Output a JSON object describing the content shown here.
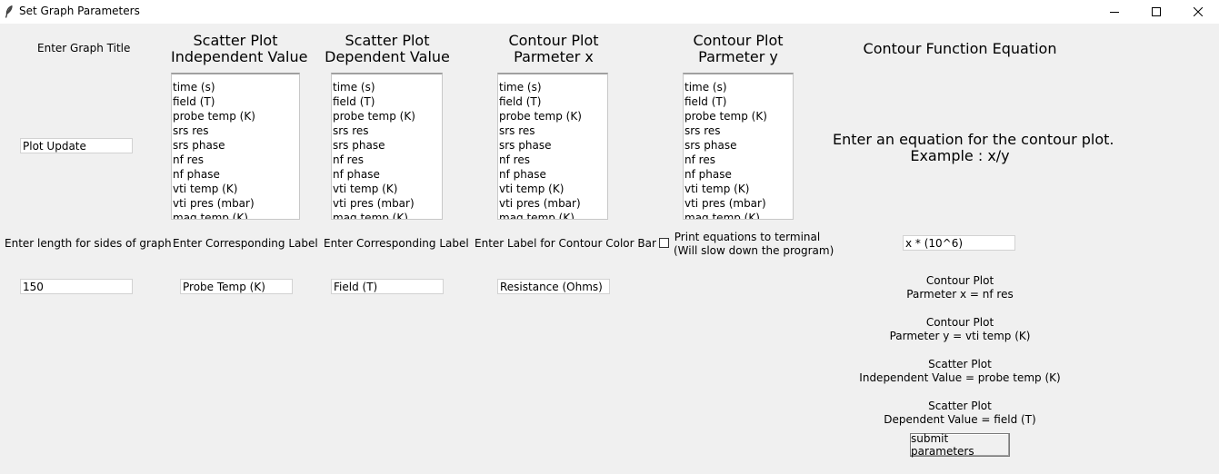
{
  "window": {
    "title": "Set Graph Parameters",
    "icon": "feather-icon",
    "controls": [
      "minimize-icon",
      "maximize-icon",
      "close-icon"
    ]
  },
  "graph_title": {
    "label": "Enter Graph Title",
    "value": "Plot Update"
  },
  "side_length": {
    "label": "Enter length for sides of graph",
    "value": "150"
  },
  "listbox_options": [
    "time (s)",
    "field (T)",
    "probe temp (K)",
    "srs res",
    "srs phase",
    "nf res",
    "nf phase",
    "vti temp (K)",
    "vti pres (mbar)",
    "mag temp (K)"
  ],
  "scatter_independent": {
    "heading_line1": "Scatter Plot",
    "heading_line2": "Independent Value",
    "label_prompt": "Enter Corresponding Label",
    "label_value": "Probe Temp (K)"
  },
  "scatter_dependent": {
    "heading_line1": "Scatter Plot",
    "heading_line2": "Dependent Value",
    "label_prompt": "Enter Corresponding Label",
    "label_value": "Field (T)"
  },
  "contour_x": {
    "heading_line1": "Contour Plot",
    "heading_line2": "Parmeter x",
    "label_prompt": "Enter Label for Contour Color Bar",
    "label_value": "Resistance (Ohms)"
  },
  "contour_y": {
    "heading_line1": "Contour Plot",
    "heading_line2": "Parmeter y",
    "checkbox_line1": "Print equations to terminal",
    "checkbox_line2": "(Will slow down the program)",
    "checked": false
  },
  "contour_equation": {
    "heading": "Contour Function Equation",
    "prompt_line1": "Enter an equation for the contour plot.",
    "prompt_line2": "Example : x/y",
    "value": "x * (10^6)"
  },
  "summary": [
    {
      "line1": "Contour Plot",
      "line2": "Parmeter x = nf res"
    },
    {
      "line1": "Contour Plot",
      "line2": "Parmeter y = vti temp (K)"
    },
    {
      "line1": "Scatter Plot",
      "line2": "Independent Value = probe temp (K)"
    },
    {
      "line1": "Scatter Plot",
      "line2": "Dependent Value = field (T)"
    }
  ],
  "submit_label": "submit parameters"
}
